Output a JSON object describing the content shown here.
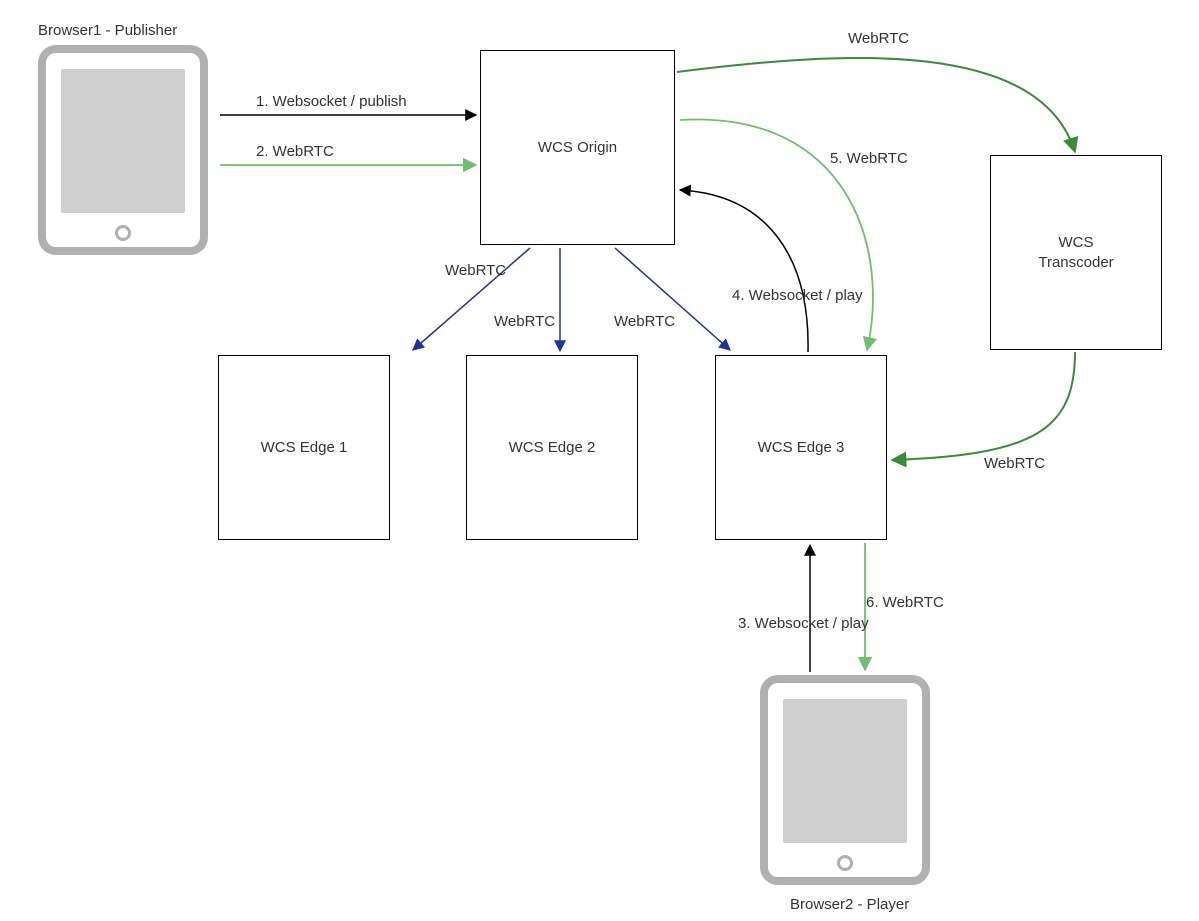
{
  "devices": {
    "publisher": {
      "label": "Browser1 - Publisher"
    },
    "player": {
      "label": "Browser2 - Player"
    }
  },
  "nodes": {
    "origin": {
      "label": "WCS Origin"
    },
    "transcoder": {
      "label": "WCS\nTranscoder"
    },
    "edge1": {
      "label": "WCS Edge 1"
    },
    "edge2": {
      "label": "WCS Edge 2"
    },
    "edge3": {
      "label": "WCS Edge 3"
    }
  },
  "arrows": {
    "pub_ws": {
      "label": "1. Websocket / publish"
    },
    "pub_webrtc": {
      "label": "2. WebRTC"
    },
    "origin_edge1": {
      "label": "WebRTC"
    },
    "origin_edge2": {
      "label": "WebRTC"
    },
    "origin_edge3": {
      "label": "WebRTC"
    },
    "origin_trans": {
      "label": "WebRTC"
    },
    "trans_edge3": {
      "label": "WebRTC"
    },
    "play_ws": {
      "label": "3. Websocket / play"
    },
    "edge3_ws": {
      "label": "4. Websocket / play"
    },
    "origin_edge3_g": {
      "label": "5. WebRTC"
    },
    "edge3_player": {
      "label": "6. WebRTC"
    }
  }
}
